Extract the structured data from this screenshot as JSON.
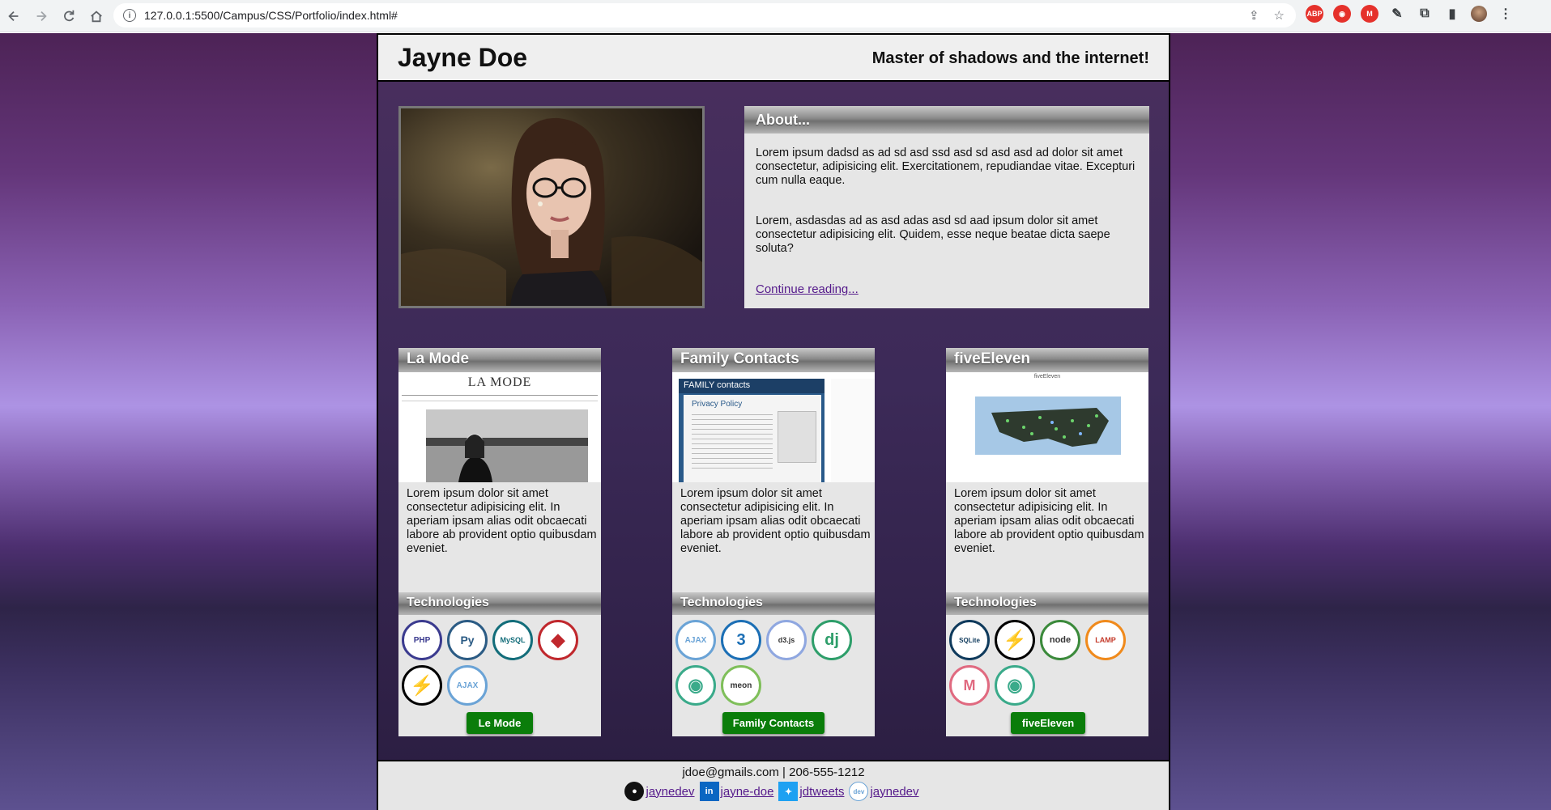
{
  "browser": {
    "url": "127.0.0.1:5500/Campus/CSS/Portfolio/index.html#"
  },
  "site": {
    "name": "Jayne Doe",
    "tagline": "Master of shadows and the internet!"
  },
  "about": {
    "heading": "About...",
    "p1": "Lorem ipsum dadsd as ad sd asd ssd asd sd asd asd ad dolor sit amet consectetur, adipisicing elit. Exercitationem, repudiandae vitae. Excepturi cum nulla eaque.",
    "p2": "Lorem, asdasdas ad as asd adas asd sd aad ipsum dolor sit amet consectetur adipisicing elit. Quidem, esse neque beatae dicta saepe soluta?",
    "link": "Continue reading..."
  },
  "projects": [
    {
      "title": "La Mode",
      "description": "Lorem ipsum dolor sit amet consectetur adipisicing elit. In aperiam ipsam alias odit obcaecati labore ab provident optio quibusdam eveniet.",
      "technologies_label": "Technologies",
      "button": "Le Mode",
      "screenshot_title": "LA MODE",
      "tech": [
        {
          "icon": "php-icon",
          "label": "PHP",
          "color": "#3b3b8f"
        },
        {
          "icon": "python-icon",
          "label": "Py",
          "color": "#2b5b84"
        },
        {
          "icon": "mysql-icon",
          "label": "MySQL",
          "color": "#136d7a"
        },
        {
          "icon": "ruby-icon",
          "label": "◆",
          "color": "#c0282d"
        },
        {
          "icon": "lightning-icon",
          "label": "⚡",
          "color": "#000000"
        },
        {
          "icon": "ajax-icon",
          "label": "AJAX",
          "color": "#6aa3d6"
        }
      ]
    },
    {
      "title": "Family Contacts",
      "description": "Lorem ipsum dolor sit amet consectetur adipisicing elit. In aperiam ipsam alias odit obcaecati labore ab provident optio quibusdam eveniet.",
      "technologies_label": "Technologies",
      "button": "Family Contacts",
      "screenshot_title": "Privacy Policy",
      "tech": [
        {
          "icon": "ajax-icon",
          "label": "AJAX",
          "color": "#6aa3d6"
        },
        {
          "icon": "css3-icon",
          "label": "3",
          "color": "#1c6fb5"
        },
        {
          "icon": "d3js-icon",
          "label": "d3.js",
          "color": "#8fa7e0"
        },
        {
          "icon": "django-icon",
          "label": "dj",
          "color": "#2e9e6a"
        },
        {
          "icon": "wave-icon",
          "label": "◉",
          "color": "#3aaa8a"
        },
        {
          "icon": "meteor-icon",
          "label": "meon",
          "color": "#7fbf5a"
        }
      ]
    },
    {
      "title": "fiveEleven",
      "description": "Lorem ipsum dolor sit amet consectetur adipisicing elit. In aperiam ipsam alias odit obcaecati labore ab provident optio quibusdam eveniet.",
      "technologies_label": "Technologies",
      "button": "fiveEleven",
      "screenshot_title": "fiveEleven",
      "tech": [
        {
          "icon": "sqlite-icon",
          "label": "SQLite",
          "color": "#0f3a5c"
        },
        {
          "icon": "lightning-icon",
          "label": "⚡",
          "color": "#000000"
        },
        {
          "icon": "node-icon",
          "label": "node",
          "color": "#3b8a3b"
        },
        {
          "icon": "lamp-icon",
          "label": "LAMP",
          "color": "#f08a1c"
        },
        {
          "icon": "m-icon",
          "label": "M",
          "color": "#e06a80"
        },
        {
          "icon": "wave-icon",
          "label": "◉",
          "color": "#3aaa8a"
        }
      ]
    }
  ],
  "footer": {
    "contact": "jdoe@gmails.com | 206-555-1212",
    "social": [
      {
        "icon": "github-icon",
        "label": "jaynedev"
      },
      {
        "icon": "linkedin-icon",
        "label": "jayne-doe"
      },
      {
        "icon": "twitter-icon",
        "label": "jdtweets"
      },
      {
        "icon": "dev-icon",
        "label": "jaynedev"
      }
    ]
  }
}
